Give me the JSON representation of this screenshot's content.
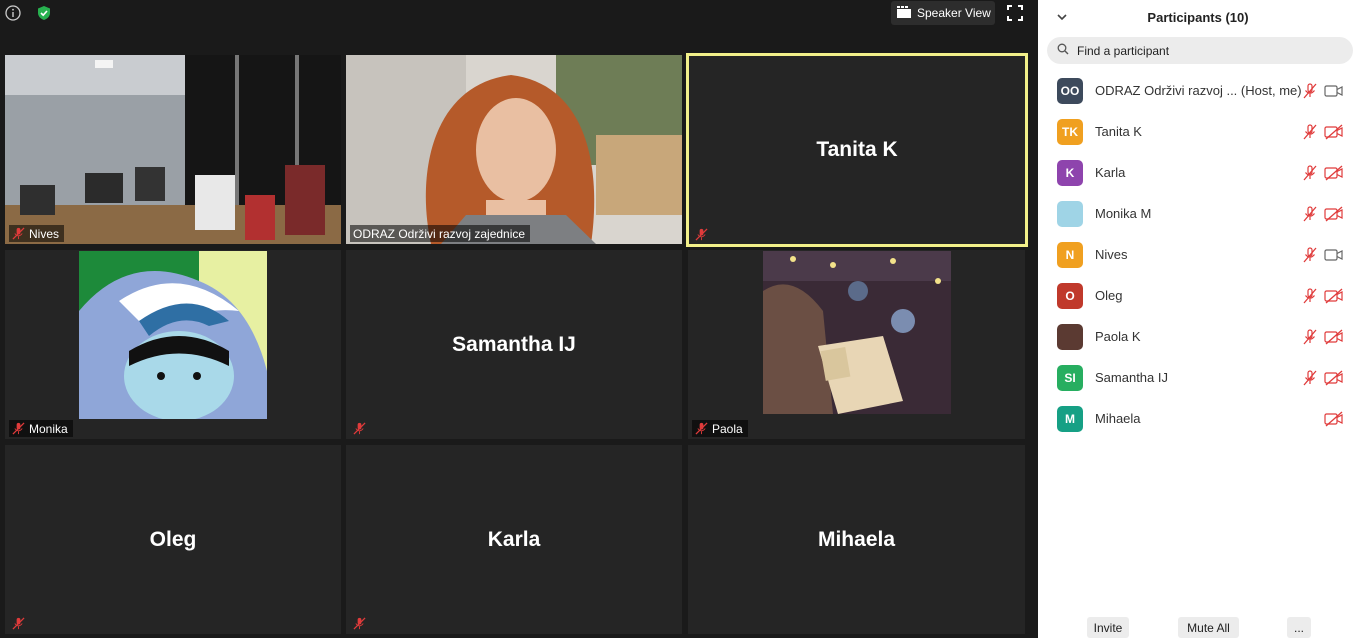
{
  "toolbar": {
    "speaker_view_label": "Speaker View"
  },
  "tiles": {
    "nives": {
      "label": "Nives"
    },
    "odraz": {
      "label": "ODRAZ Održivi razvoj zajednice"
    },
    "tanita": {
      "bigname": "Tanita K"
    },
    "monika": {
      "label": "Monika"
    },
    "samantha": {
      "bigname": "Samantha IJ"
    },
    "paola": {
      "label": "Paola"
    },
    "oleg": {
      "bigname": "Oleg"
    },
    "karla": {
      "bigname": "Karla"
    },
    "mihaela": {
      "bigname": "Mihaela"
    }
  },
  "panel": {
    "title": "Participants (10)",
    "search_placeholder": "Find a participant",
    "participants": [
      {
        "initials": "OO",
        "name": "ODRAZ Održivi razvoj ... (Host, me)",
        "color": "#3d4a5c",
        "mic": "muted",
        "cam": "on"
      },
      {
        "initials": "TK",
        "name": "Tanita K",
        "color": "#f0a020",
        "mic": "muted",
        "cam": "off"
      },
      {
        "initials": "K",
        "name": "Karla",
        "color": "#8e44ad",
        "mic": "muted",
        "cam": "off"
      },
      {
        "initials": "",
        "name": "Monika M",
        "color": "#9fd4e6",
        "mic": "muted",
        "cam": "off"
      },
      {
        "initials": "N",
        "name": "Nives",
        "color": "#f0a020",
        "mic": "muted",
        "cam": "on"
      },
      {
        "initials": "O",
        "name": "Oleg",
        "color": "#c0392b",
        "mic": "muted",
        "cam": "off"
      },
      {
        "initials": "",
        "name": "Paola K",
        "color": "#5b3a32",
        "mic": "muted",
        "cam": "off"
      },
      {
        "initials": "SI",
        "name": "Samantha IJ",
        "color": "#27ae60",
        "mic": "muted",
        "cam": "off"
      },
      {
        "initials": "M",
        "name": "Mihaela",
        "color": "#16a085",
        "mic": "none",
        "cam": "off"
      }
    ],
    "invite_label": "Invite",
    "mute_all_label": "Mute All",
    "more_label": "..."
  }
}
